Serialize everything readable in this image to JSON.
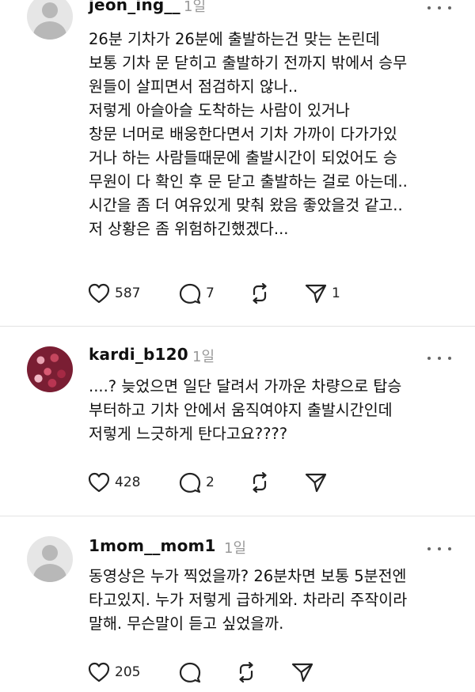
{
  "posts": [
    {
      "username": "jeon_ing__",
      "time": "1일",
      "lines": [
        "26분 기차가 26분에 출발하는건 맞는 논린데",
        "보통 기차 문 닫히고 출발하기 전까지 밖에서 승무",
        "원들이 살피면서 점검하지 않나..",
        "저렇게 아슬아슬 도착하는 사람이 있거나",
        "창문 너머로 배웅한다면서 기차 가까이 다가가있",
        "거나 하는 사람들때문에 출발시간이 되었어도 승",
        "무원이 다 확인 후 문 닫고 출발하는 걸로 아는데..",
        "시간을 좀 더 여유있게 맞춰 왔음 좋았을것 같고..",
        "저 상황은 좀 위험하긴했겠다..."
      ],
      "likes": "587",
      "replies": "7",
      "reposts": "",
      "shares": "1"
    },
    {
      "username": "kardi_b120",
      "time": "1일",
      "lines": [
        "....? 늦었으면 일단 달려서 가까운 차량으로 탑승",
        "부터하고 기차 안에서 움직여야지 출발시간인데",
        "저렇게 느긋하게 탄다고요????"
      ],
      "likes": "428",
      "replies": "2",
      "reposts": "",
      "shares": ""
    },
    {
      "username": "1mom__mom1",
      "time": "1일",
      "lines": [
        "동영상은 누가 찍었을까? 26분차면 보통 5분전엔",
        "타고있지. 누가 저렇게 급하게와. 차라리 주작이라",
        "말해. 무슨말이 듣고 싶었을까."
      ],
      "likes": "205",
      "replies": "",
      "reposts": "",
      "shares": ""
    }
  ],
  "icons": {
    "like": "heart-icon",
    "reply": "speech-bubble-icon",
    "repost": "repost-icon",
    "share": "send-icon",
    "more": "more-dots-icon"
  }
}
